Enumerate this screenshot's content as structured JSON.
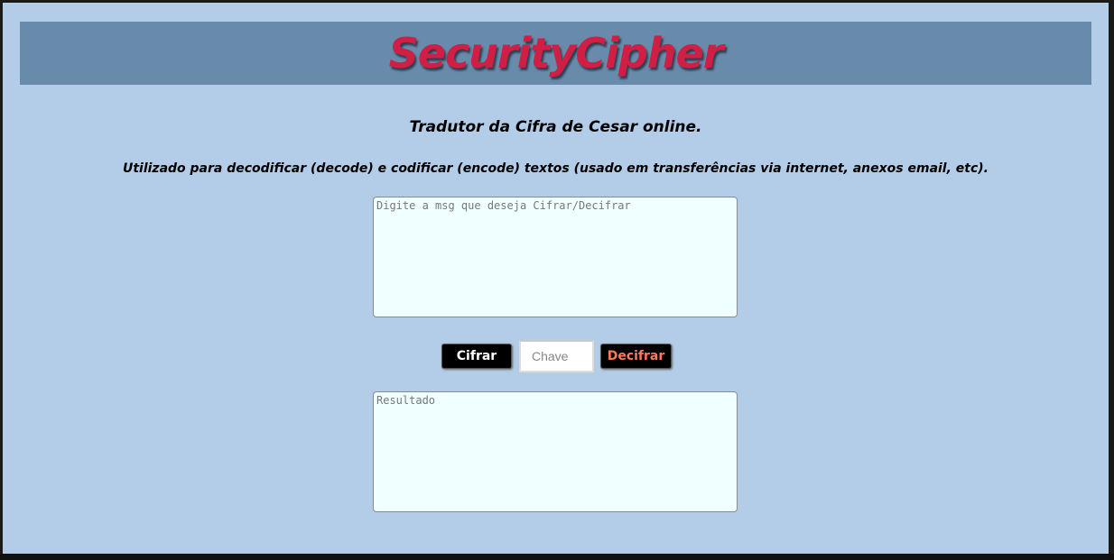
{
  "header": {
    "brand": "SecurityCipher"
  },
  "intro": {
    "subtitle": "Tradutor da Cifra de Cesar online.",
    "description": "Utilizado para decodificar (decode) e codificar (encode) textos (usado em transferências via internet, anexos email, etc)."
  },
  "message_input": {
    "placeholder": "Digite a msg que deseja Cifrar/Decifrar",
    "value": ""
  },
  "controls": {
    "encrypt_label": "Cifrar",
    "key_placeholder": "Chave",
    "key_value": "",
    "decrypt_label": "Decifrar"
  },
  "result_output": {
    "placeholder": "Resultado",
    "value": ""
  },
  "colors": {
    "page_background": "#b3cde8",
    "header_background": "#698bab",
    "brand_text": "#d01f45",
    "textarea_background": "#f0ffff",
    "button_background": "#000000",
    "encrypt_text": "#ffffff",
    "decrypt_text": "#ff7a5c"
  }
}
